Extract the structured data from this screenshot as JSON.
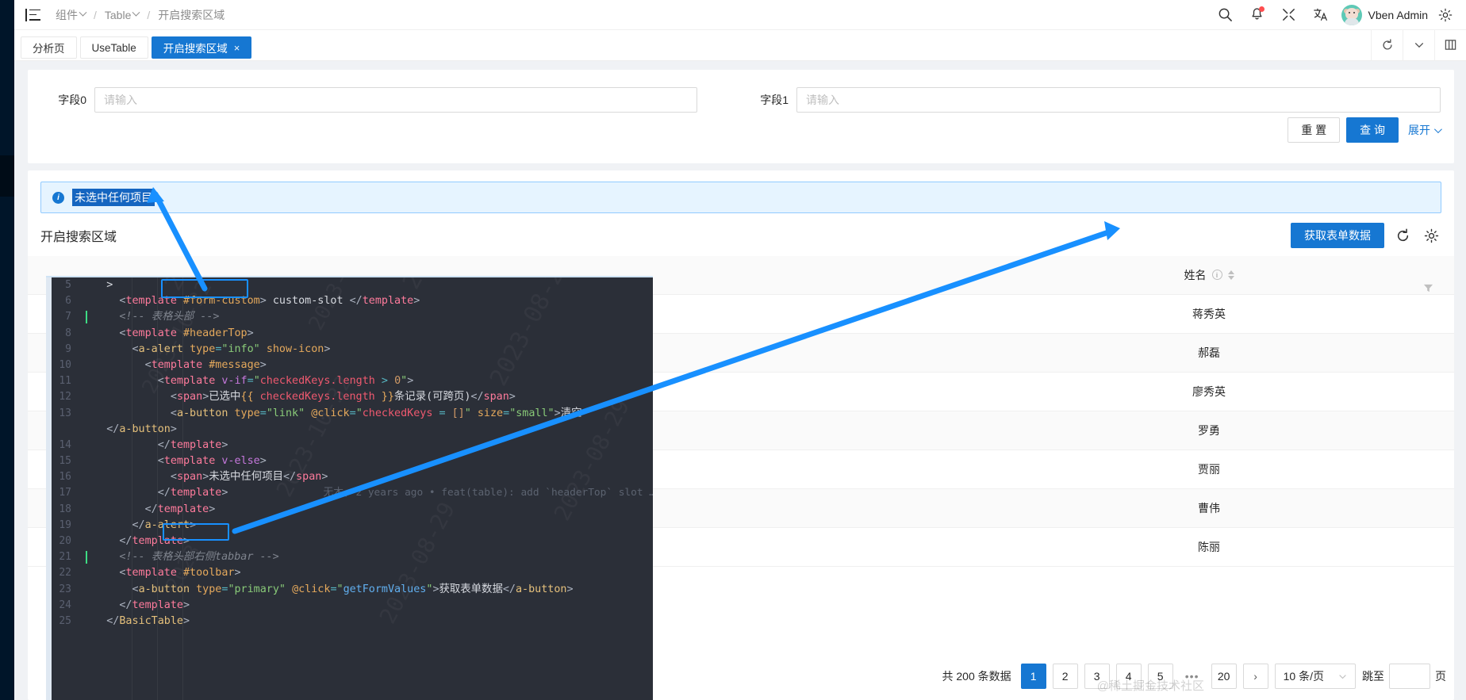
{
  "header": {
    "menu_icon": "menu-fold-icon",
    "breadcrumb": [
      {
        "label": "组件",
        "has_chevron": true
      },
      {
        "label": "Table",
        "has_chevron": true
      },
      {
        "label": "开启搜索区域",
        "has_chevron": false
      }
    ],
    "separator": "/",
    "icons": [
      "search-icon",
      "bell-icon",
      "fullscreen-icon",
      "translate-icon"
    ],
    "username": "Vben Admin",
    "notification_badge": true
  },
  "tabs": {
    "items": [
      {
        "label": "分析页",
        "active": false,
        "closable": false
      },
      {
        "label": "UseTable",
        "active": false,
        "closable": false
      },
      {
        "label": "开启搜索区域",
        "active": true,
        "closable": true,
        "close": "×"
      }
    ],
    "right_icons": [
      "reload-icon",
      "chevron-down-icon",
      "column-icon"
    ]
  },
  "search_form": {
    "fields": [
      {
        "label": "字段0",
        "value": "",
        "placeholder": "请输入"
      },
      {
        "label": "字段1",
        "value": "",
        "placeholder": "请输入"
      }
    ],
    "reset_label": "重 置",
    "query_label": "查 询",
    "expand_label": "展开"
  },
  "alert": {
    "icon": "info-circle-icon",
    "message": "未选中任何项目",
    "selected": true
  },
  "table": {
    "title": "开启搜索区域",
    "toolbar_button": "获取表单数据",
    "toolbar_icons": [
      "reload-icon",
      "gear-icon"
    ],
    "columns": [
      {
        "label": "姓名",
        "has_help": true,
        "has_sorter": true,
        "has_filter": true
      }
    ],
    "rows": [
      {
        "name": "蒋秀英"
      },
      {
        "name": "郝磊"
      },
      {
        "name": "廖秀英"
      },
      {
        "name": "罗勇"
      },
      {
        "name": "贾丽"
      },
      {
        "name": "曹伟"
      },
      {
        "name": "陈丽"
      }
    ]
  },
  "pagination": {
    "total_text": "共 200 条数据",
    "pages": [
      "1",
      "2",
      "3",
      "4",
      "5",
      "•••",
      "20"
    ],
    "current": "1",
    "next_arrow": "›",
    "page_size": "10 条/页",
    "jump_label": "跳至",
    "jump_value": "",
    "jump_unit": "页"
  },
  "code": {
    "lines": [
      {
        "n": "5",
        "tokens": [
          {
            "t": "plain",
            "s": "    >"
          }
        ]
      },
      {
        "n": "6",
        "tokens": [
          {
            "t": "punc",
            "s": "      <"
          },
          {
            "t": "tag",
            "s": "template"
          },
          {
            "t": "plain",
            "s": " "
          },
          {
            "t": "attr",
            "s": "#form-custom"
          },
          {
            "t": "punc",
            "s": ">"
          },
          {
            "t": "plain",
            "s": " custom-slot "
          },
          {
            "t": "punc",
            "s": "</"
          },
          {
            "t": "tag",
            "s": "template"
          },
          {
            "t": "punc",
            "s": ">"
          }
        ]
      },
      {
        "n": "7",
        "caret": true,
        "tokens": [
          {
            "t": "cmt",
            "s": "      <!-- 表格头部 -->"
          }
        ]
      },
      {
        "n": "8",
        "tokens": [
          {
            "t": "punc",
            "s": "      <"
          },
          {
            "t": "tag",
            "s": "template"
          },
          {
            "t": "plain",
            "s": " "
          },
          {
            "t": "attr",
            "s": "#headerTop"
          },
          {
            "t": "punc",
            "s": ">"
          }
        ]
      },
      {
        "n": "9",
        "tokens": [
          {
            "t": "punc",
            "s": "        <"
          },
          {
            "t": "tag2",
            "s": "a-alert"
          },
          {
            "t": "plain",
            "s": " "
          },
          {
            "t": "attr",
            "s": "type"
          },
          {
            "t": "op",
            "s": "="
          },
          {
            "t": "str",
            "s": "\"info\""
          },
          {
            "t": "plain",
            "s": " "
          },
          {
            "t": "attr",
            "s": "show-icon"
          },
          {
            "t": "punc",
            "s": ">"
          }
        ]
      },
      {
        "n": "10",
        "tokens": [
          {
            "t": "punc",
            "s": "          <"
          },
          {
            "t": "tag",
            "s": "template"
          },
          {
            "t": "plain",
            "s": " "
          },
          {
            "t": "attr",
            "s": "#message"
          },
          {
            "t": "punc",
            "s": ">"
          }
        ]
      },
      {
        "n": "11",
        "tokens": [
          {
            "t": "punc",
            "s": "            <"
          },
          {
            "t": "tag",
            "s": "template"
          },
          {
            "t": "plain",
            "s": " "
          },
          {
            "t": "kw",
            "s": "v-if"
          },
          {
            "t": "op",
            "s": "="
          },
          {
            "t": "str",
            "s": "\""
          },
          {
            "t": "val",
            "s": "checkedKeys.length"
          },
          {
            "t": "op",
            "s": " > "
          },
          {
            "t": "attr2",
            "s": "0"
          },
          {
            "t": "str",
            "s": "\""
          },
          {
            "t": "punc",
            "s": ">"
          }
        ]
      },
      {
        "n": "12",
        "tokens": [
          {
            "t": "punc",
            "s": "              <"
          },
          {
            "t": "tag",
            "s": "span"
          },
          {
            "t": "punc",
            "s": ">"
          },
          {
            "t": "plain",
            "s": "已选中"
          },
          {
            "t": "attr",
            "s": "{{"
          },
          {
            "t": "val",
            "s": " checkedKeys.length "
          },
          {
            "t": "attr",
            "s": "}}"
          },
          {
            "t": "plain",
            "s": "条记录(可跨页)"
          },
          {
            "t": "punc",
            "s": "</"
          },
          {
            "t": "tag",
            "s": "span"
          },
          {
            "t": "punc",
            "s": ">"
          }
        ]
      },
      {
        "n": "13",
        "tokens": [
          {
            "t": "punc",
            "s": "              <"
          },
          {
            "t": "tag2",
            "s": "a-button"
          },
          {
            "t": "plain",
            "s": " "
          },
          {
            "t": "attr",
            "s": "type"
          },
          {
            "t": "op",
            "s": "="
          },
          {
            "t": "str",
            "s": "\"link\""
          },
          {
            "t": "plain",
            "s": " "
          },
          {
            "t": "attr",
            "s": "@click"
          },
          {
            "t": "op",
            "s": "="
          },
          {
            "t": "str",
            "s": "\""
          },
          {
            "t": "val",
            "s": "checkedKeys"
          },
          {
            "t": "op",
            "s": " = "
          },
          {
            "t": "attr2",
            "s": "[]"
          },
          {
            "t": "str",
            "s": "\""
          },
          {
            "t": "plain",
            "s": " "
          },
          {
            "t": "attr",
            "s": "size"
          },
          {
            "t": "op",
            "s": "="
          },
          {
            "t": "str",
            "s": "\"small\""
          },
          {
            "t": "punc",
            "s": ">"
          },
          {
            "t": "plain",
            "s": "清空"
          }
        ]
      },
      {
        "n": "",
        "tokens": [
          {
            "t": "punc",
            "s": "    </"
          },
          {
            "t": "tag2",
            "s": "a-button"
          },
          {
            "t": "punc",
            "s": ">"
          }
        ]
      },
      {
        "n": "14",
        "tokens": [
          {
            "t": "punc",
            "s": "            </"
          },
          {
            "t": "tag",
            "s": "template"
          },
          {
            "t": "punc",
            "s": ">"
          }
        ]
      },
      {
        "n": "15",
        "tokens": [
          {
            "t": "punc",
            "s": "            <"
          },
          {
            "t": "tag",
            "s": "template"
          },
          {
            "t": "plain",
            "s": " "
          },
          {
            "t": "kw",
            "s": "v-else"
          },
          {
            "t": "punc",
            "s": ">"
          }
        ]
      },
      {
        "n": "16",
        "tokens": [
          {
            "t": "punc",
            "s": "              <"
          },
          {
            "t": "tag",
            "s": "span"
          },
          {
            "t": "punc",
            "s": ">"
          },
          {
            "t": "plain",
            "s": "未选中任何项目"
          },
          {
            "t": "punc",
            "s": "</"
          },
          {
            "t": "tag",
            "s": "span"
          },
          {
            "t": "punc",
            "s": ">"
          }
        ]
      },
      {
        "n": "17",
        "blame": "无木, 2 years ago • feat(table): add `headerTop` slot …",
        "tokens": [
          {
            "t": "punc",
            "s": "            </"
          },
          {
            "t": "tag",
            "s": "template"
          },
          {
            "t": "punc",
            "s": ">"
          }
        ]
      },
      {
        "n": "18",
        "tokens": [
          {
            "t": "punc",
            "s": "          </"
          },
          {
            "t": "tag",
            "s": "template"
          },
          {
            "t": "punc",
            "s": ">"
          }
        ]
      },
      {
        "n": "19",
        "tokens": [
          {
            "t": "punc",
            "s": "        </"
          },
          {
            "t": "tag2",
            "s": "a-alert"
          },
          {
            "t": "punc",
            "s": ">"
          }
        ]
      },
      {
        "n": "20",
        "tokens": [
          {
            "t": "punc",
            "s": "      </"
          },
          {
            "t": "tag",
            "s": "template"
          },
          {
            "t": "punc",
            "s": ">"
          }
        ]
      },
      {
        "n": "21",
        "caret": true,
        "tokens": [
          {
            "t": "cmt",
            "s": "      <!-- 表格头部右侧tabbar -->"
          }
        ]
      },
      {
        "n": "22",
        "tokens": [
          {
            "t": "punc",
            "s": "      <"
          },
          {
            "t": "tag",
            "s": "template"
          },
          {
            "t": "plain",
            "s": " "
          },
          {
            "t": "attr",
            "s": "#toolbar"
          },
          {
            "t": "punc",
            "s": ">"
          }
        ]
      },
      {
        "n": "23",
        "tokens": [
          {
            "t": "punc",
            "s": "        <"
          },
          {
            "t": "tag2",
            "s": "a-button"
          },
          {
            "t": "plain",
            "s": " "
          },
          {
            "t": "attr",
            "s": "type"
          },
          {
            "t": "op",
            "s": "="
          },
          {
            "t": "str",
            "s": "\"primary\""
          },
          {
            "t": "plain",
            "s": " "
          },
          {
            "t": "attr",
            "s": "@click"
          },
          {
            "t": "op",
            "s": "="
          },
          {
            "t": "str",
            "s": "\""
          },
          {
            "t": "fn",
            "s": "getFormValues"
          },
          {
            "t": "str",
            "s": "\""
          },
          {
            "t": "punc",
            "s": ">"
          },
          {
            "t": "plain",
            "s": "获取表单数据"
          },
          {
            "t": "punc",
            "s": "</"
          },
          {
            "t": "tag2",
            "s": "a-button"
          },
          {
            "t": "punc",
            "s": ">"
          }
        ]
      },
      {
        "n": "24",
        "tokens": [
          {
            "t": "punc",
            "s": "      </"
          },
          {
            "t": "tag",
            "s": "template"
          },
          {
            "t": "punc",
            "s": ">"
          }
        ]
      },
      {
        "n": "25",
        "tokens": [
          {
            "t": "punc",
            "s": "    </"
          },
          {
            "t": "tag2",
            "s": "BasicTable"
          },
          {
            "t": "punc",
            "s": ">"
          }
        ]
      }
    ],
    "highlight_labels": [
      "#headerTop",
      "#toolbar"
    ],
    "watermarks": [
      "2023-08-29",
      "2023-08-29",
      "2023-10-32",
      "2023-08-29-1",
      "2023-10-32",
      "2023"
    ],
    "accent_color": "#1890ff"
  },
  "watermark": "@稀土掘金技术社区"
}
